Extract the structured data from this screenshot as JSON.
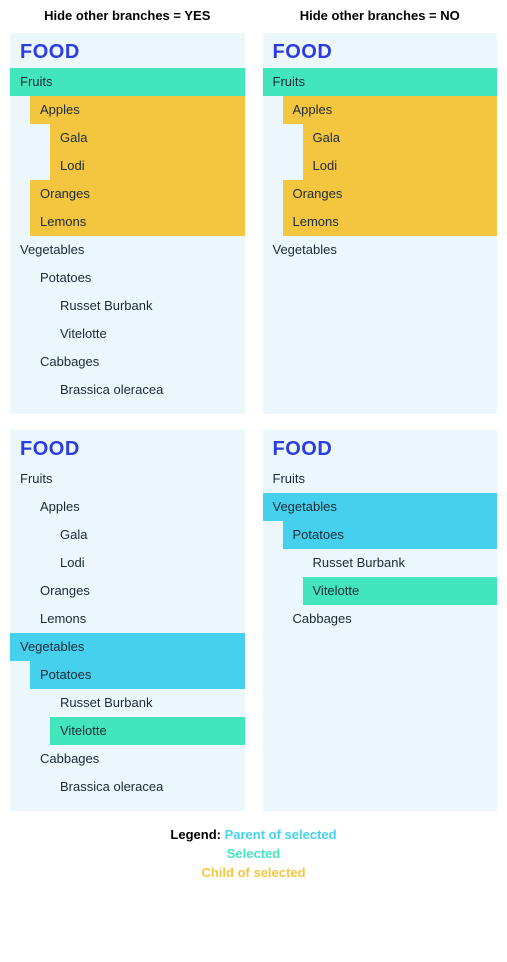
{
  "columns": {
    "left": "Hide other branches = YES",
    "right": "Hide other branches = NO"
  },
  "rootLabel": "FOOD",
  "panels": [
    {
      "id": "yes-fruits",
      "rows": [
        {
          "label": "Fruits",
          "depth": 0,
          "state": "selected"
        },
        {
          "label": "Apples",
          "depth": 1,
          "state": "child"
        },
        {
          "label": "Gala",
          "depth": 2,
          "state": "child"
        },
        {
          "label": "Lodi",
          "depth": 2,
          "state": "child"
        },
        {
          "label": "Oranges",
          "depth": 1,
          "state": "child"
        },
        {
          "label": "Lemons",
          "depth": 1,
          "state": "child"
        },
        {
          "label": "Vegetables",
          "depth": 0,
          "state": "none"
        },
        {
          "label": "Potatoes",
          "depth": 1,
          "state": "none"
        },
        {
          "label": "Russet Burbank",
          "depth": 2,
          "state": "none"
        },
        {
          "label": "Vitelotte",
          "depth": 2,
          "state": "none"
        },
        {
          "label": "Cabbages",
          "depth": 1,
          "state": "none"
        },
        {
          "label": "Brassica oleracea",
          "depth": 2,
          "state": "none"
        }
      ]
    },
    {
      "id": "no-fruits",
      "rows": [
        {
          "label": "Fruits",
          "depth": 0,
          "state": "selected"
        },
        {
          "label": "Apples",
          "depth": 1,
          "state": "child"
        },
        {
          "label": "Gala",
          "depth": 2,
          "state": "child"
        },
        {
          "label": "Lodi",
          "depth": 2,
          "state": "child"
        },
        {
          "label": "Oranges",
          "depth": 1,
          "state": "child"
        },
        {
          "label": "Lemons",
          "depth": 1,
          "state": "child"
        },
        {
          "label": "Vegetables",
          "depth": 0,
          "state": "none"
        }
      ]
    },
    {
      "id": "yes-vitelotte",
      "rows": [
        {
          "label": "Fruits",
          "depth": 0,
          "state": "none"
        },
        {
          "label": "Apples",
          "depth": 1,
          "state": "none"
        },
        {
          "label": "Gala",
          "depth": 2,
          "state": "none"
        },
        {
          "label": "Lodi",
          "depth": 2,
          "state": "none"
        },
        {
          "label": "Oranges",
          "depth": 1,
          "state": "none"
        },
        {
          "label": "Lemons",
          "depth": 1,
          "state": "none"
        },
        {
          "label": "Vegetables",
          "depth": 0,
          "state": "parent"
        },
        {
          "label": "Potatoes",
          "depth": 1,
          "state": "parent"
        },
        {
          "label": "Russet Burbank",
          "depth": 2,
          "state": "none"
        },
        {
          "label": "Vitelotte",
          "depth": 2,
          "state": "selected"
        },
        {
          "label": "Cabbages",
          "depth": 1,
          "state": "none"
        },
        {
          "label": "Brassica oleracea",
          "depth": 2,
          "state": "none"
        }
      ]
    },
    {
      "id": "no-vitelotte",
      "rows": [
        {
          "label": "Fruits",
          "depth": 0,
          "state": "none"
        },
        {
          "label": "Vegetables",
          "depth": 0,
          "state": "parent"
        },
        {
          "label": "Potatoes",
          "depth": 1,
          "state": "parent"
        },
        {
          "label": "Russet Burbank",
          "depth": 2,
          "state": "none"
        },
        {
          "label": "Vitelotte",
          "depth": 2,
          "state": "selected"
        },
        {
          "label": "Cabbages",
          "depth": 1,
          "state": "none"
        }
      ]
    }
  ],
  "legend": {
    "label": "Legend:",
    "parent": "Parent of selected",
    "selected": "Selected",
    "child": "Child of selected"
  }
}
